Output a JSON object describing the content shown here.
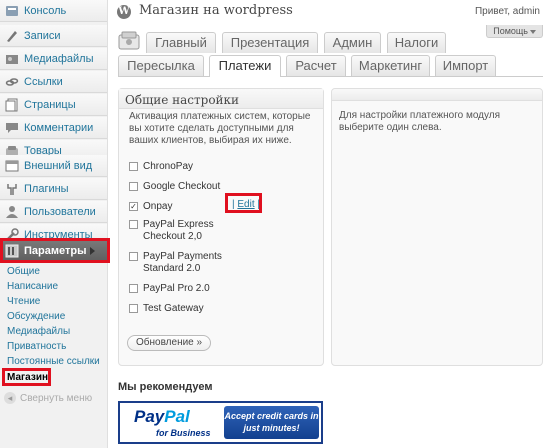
{
  "sidebar": {
    "items": [
      {
        "label": "Консоль",
        "icon": "dashboard-icon"
      },
      {
        "label": "Записи",
        "icon": "posts-icon"
      },
      {
        "label": "Медиафайлы",
        "icon": "media-icon"
      },
      {
        "label": "Ссылки",
        "icon": "links-icon"
      },
      {
        "label": "Страницы",
        "icon": "pages-icon"
      },
      {
        "label": "Комментарии",
        "icon": "comments-icon"
      },
      {
        "label": "Товары",
        "icon": "products-icon"
      },
      {
        "label": "Внешний вид",
        "icon": "appearance-icon"
      },
      {
        "label": "Плагины",
        "icon": "plugins-icon"
      },
      {
        "label": "Пользователи",
        "icon": "users-icon"
      },
      {
        "label": "Инструменты",
        "icon": "tools-icon"
      },
      {
        "label": "Параметры",
        "icon": "settings-icon"
      }
    ],
    "submenu": [
      "Общие",
      "Написание",
      "Чтение",
      "Обсуждение",
      "Медиафайлы",
      "Приватность",
      "Постоянные ссылки",
      "Магазин"
    ],
    "collapse_label": "Свернуть меню"
  },
  "header": {
    "site_title": "Магазин на wordpress",
    "howdy": "Привет, admin",
    "help": "Помощь"
  },
  "tabs_row1": [
    "Главный",
    "Презентация",
    "Админ",
    "Налоги"
  ],
  "tabs_row2": [
    "Пересылка",
    "Платежи",
    "Расчет",
    "Маркетинг",
    "Импорт"
  ],
  "settings": {
    "title": "Общие настройки",
    "description": "Активация платежных систем, которые вы хотите сделать доступными для ваших клиентов, выбирая их ниже.",
    "gateways": [
      {
        "label": "ChronoPay",
        "checked": false
      },
      {
        "label": "Google Checkout",
        "checked": false
      },
      {
        "label": "Onpay",
        "checked": true
      },
      {
        "label": "PayPal Express Checkout 2,0",
        "checked": false
      },
      {
        "label": "PayPal Payments Standard 2.0",
        "checked": false
      },
      {
        "label": "PayPal Pro 2.0",
        "checked": false
      },
      {
        "label": "Test Gateway",
        "checked": false
      }
    ],
    "edit_prefix": "| ",
    "edit_label": "Edit",
    "edit_suffix": " |",
    "update_button": "Обновление »"
  },
  "right_panel": {
    "text": "Для настройки платежного модуля выберите один слева."
  },
  "recommend": {
    "title": "Мы рекомендуем",
    "paypal_logo_a": "Pay",
    "paypal_logo_b": "Pal",
    "paypal_sub": "for Business",
    "paypal_cta": "Accept credit cards in just minutes!"
  },
  "colors": {
    "link": "#21759b",
    "highlight": "#e0101f",
    "active_menu": "#6d6d6d",
    "paypal_dark": "#003087"
  }
}
